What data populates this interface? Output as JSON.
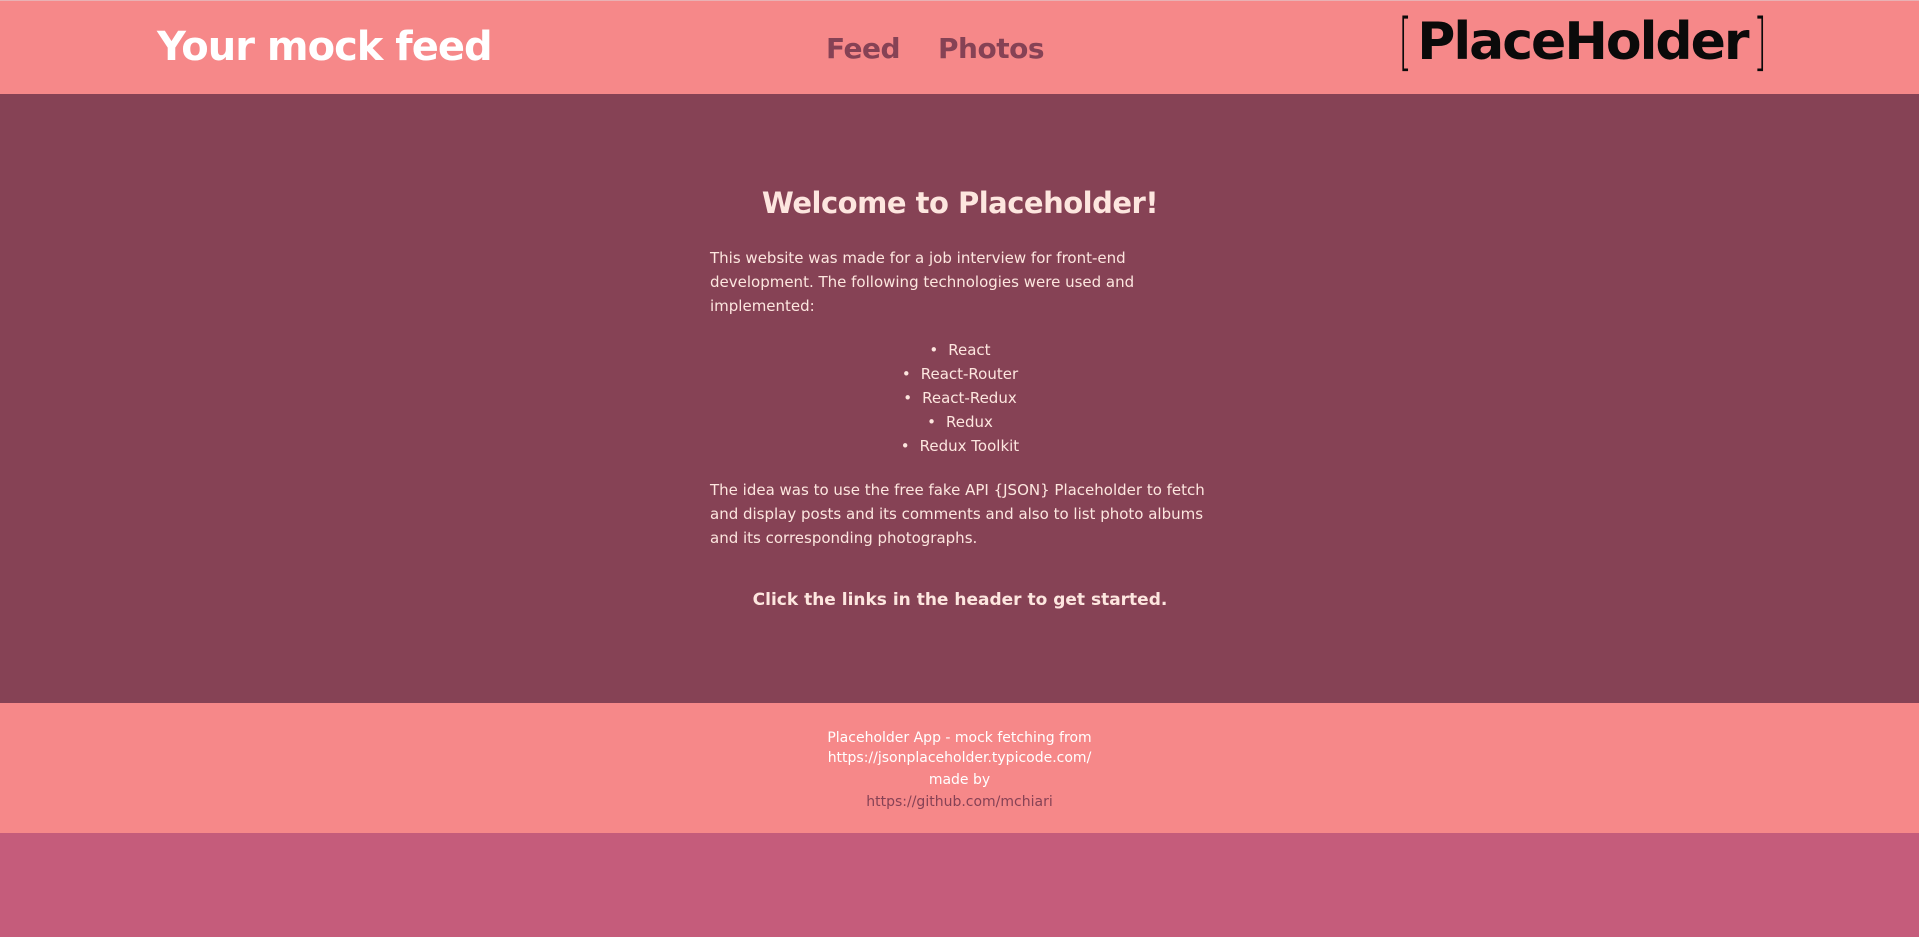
{
  "header": {
    "title": "Your mock feed",
    "nav": [
      {
        "label": "Feed"
      },
      {
        "label": "Photos"
      }
    ],
    "logo": {
      "bracket_open": "[",
      "text": "PlaceHolder",
      "bracket_close": "]"
    }
  },
  "main": {
    "heading": "Welcome to Placeholder!",
    "intro": "This website was made for a job interview for front-end development. The following technologies were used and implemented:",
    "technologies": [
      "React",
      "React-Router",
      "React-Redux",
      "Redux",
      "Redux Toolkit"
    ],
    "idea": "The idea was to use the free fake API {JSON} Placeholder to fetch and display posts and its comments and also to list photo albums and its corresponding photographs.",
    "cta": "Click the links in the header to get started."
  },
  "footer": {
    "line1": "Placeholder App - mock fetching from",
    "api_link": "https://jsonplaceholder.typicode.com/",
    "made_by": "made by",
    "author_link": "https://github.com/mchiari"
  },
  "colors": {
    "header_bg": "#f68889",
    "main_bg": "#864255",
    "page_bg": "#c55c7b",
    "nav_text": "#864255",
    "body_text": "#fde6df"
  }
}
